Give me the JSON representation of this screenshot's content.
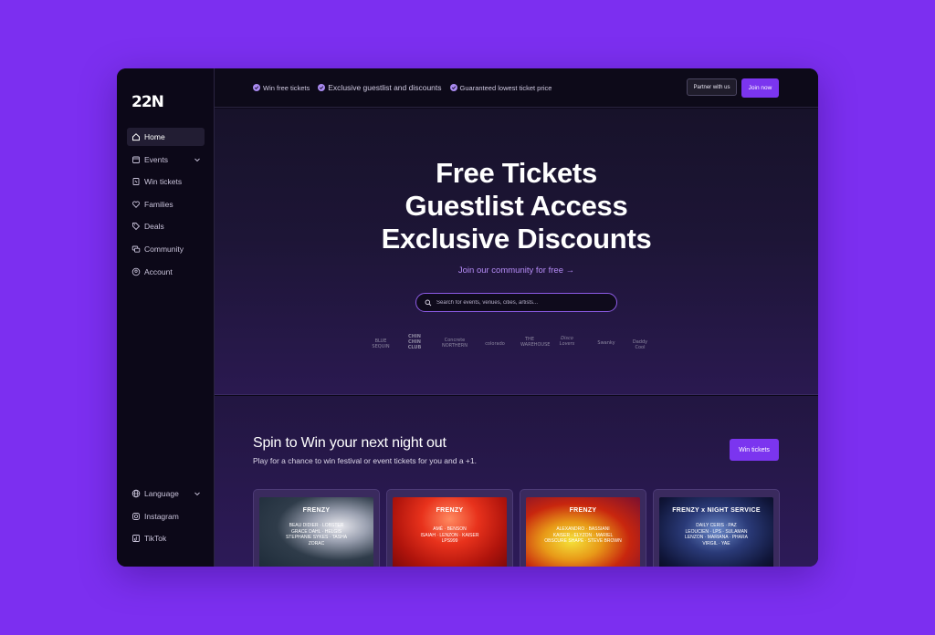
{
  "brand": {
    "logo": "22N"
  },
  "sidebar": {
    "items": [
      {
        "label": "Home",
        "icon": "home-icon",
        "active": true
      },
      {
        "label": "Events",
        "icon": "calendar-icon",
        "expandable": true
      },
      {
        "label": "Win tickets",
        "icon": "ticket-icon"
      },
      {
        "label": "Families",
        "icon": "heart-icon"
      },
      {
        "label": "Deals",
        "icon": "tag-icon"
      },
      {
        "label": "Community",
        "icon": "chat-icon"
      },
      {
        "label": "Account",
        "icon": "user-circle-icon"
      }
    ],
    "bottom": [
      {
        "label": "Language",
        "icon": "globe-icon",
        "expandable": true
      },
      {
        "label": "Instagram",
        "icon": "instagram-icon"
      },
      {
        "label": "TikTok",
        "icon": "tiktok-icon"
      }
    ]
  },
  "topbar": {
    "perks": [
      "Win free tickets",
      "Exclusive guestlist and discounts",
      "Guaranteed lowest ticket price"
    ],
    "partner_label": "Partner with us",
    "join_label": "Join now"
  },
  "hero": {
    "headline": [
      "Free Tickets",
      "Guestlist Access",
      "Exclusive Discounts"
    ],
    "join_link": "Join our community for free →",
    "search_placeholder": "Search for events, venues, cities, artists...",
    "partners": [
      "BLUE SEQUIN",
      "CHIN CHIN CLUB",
      "Concrete NORTHERN",
      "colorado",
      "THE WAREHOUSE",
      "Disco Lovers",
      "Swanky",
      "Daddy Cool"
    ]
  },
  "spin": {
    "title": "Spin to Win your next night out",
    "subtitle": "Play for a chance to win festival or event tickets for you and a +1.",
    "button_label": "Win tickets",
    "cards": [
      {
        "title": "FRENZY",
        "lineup": [
          "BEAU DIDIER · LOBSTER",
          "GRACE DAHL · HELGIS",
          "STEPHANIE SYKES · TASHA",
          "ZORAC"
        ]
      },
      {
        "title": "FRENZY",
        "lineup": [
          "AMÉ · BENSON",
          "ISAIAH · LENZON · KAISER",
          "LPS999"
        ]
      },
      {
        "title": "FRENZY",
        "lineup": [
          "ALEXANDRO · BASSIANI",
          "KAISER · ELYZON · MARIEL",
          "OBSCURE SHAPE · STEVE BROWN"
        ]
      },
      {
        "title": "FRENZY x NIGHT SERVICE",
        "lineup": [
          "DAILY CERIS · PAZ",
          "LEOUCIEN · LPS · SULAMAN",
          "LENZON · MARIANA · PHARA",
          "VIRGIL · YAE"
        ]
      }
    ]
  },
  "colors": {
    "accent": "#7b35ef",
    "background": "#7c2ff0",
    "panel": "#0c0818"
  }
}
